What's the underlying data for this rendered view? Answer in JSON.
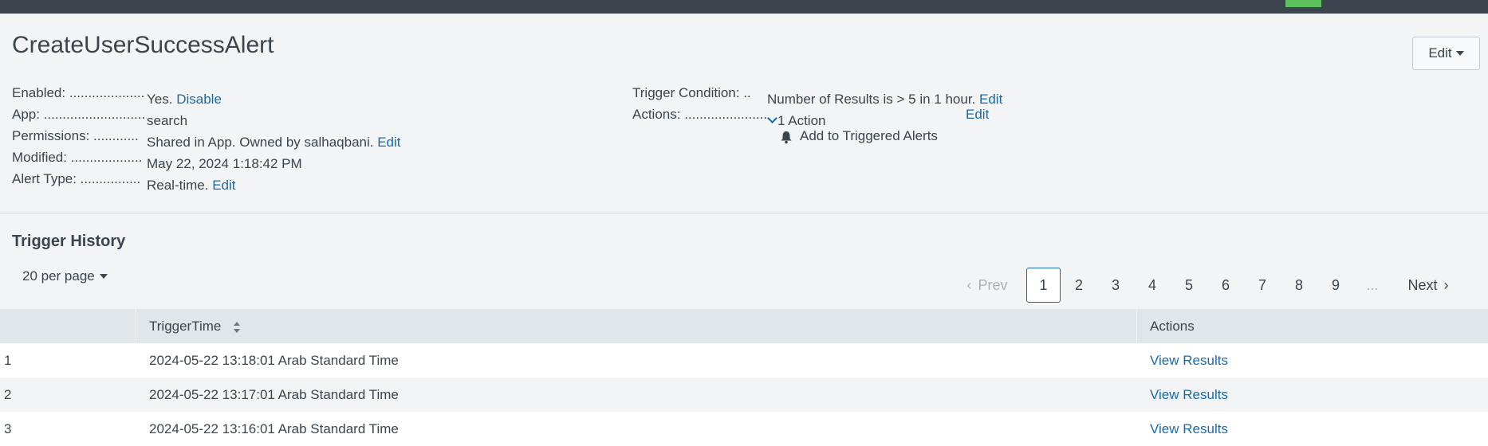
{
  "alert": {
    "title": "CreateUserSuccessAlert",
    "edit_button": "Edit"
  },
  "details_left": [
    {
      "label": "Enabled: ....................",
      "value": "Yes.",
      "link": "Disable"
    },
    {
      "label": "App: ..............................",
      "value": "search",
      "link": ""
    },
    {
      "label": "Permissions: ............",
      "value": "Shared in App. Owned by salhaqbani.",
      "link": "Edit"
    },
    {
      "label": "Modified: ...................",
      "value": "May 22, 2024 1:18:42 PM",
      "link": ""
    },
    {
      "label": "Alert Type: ................",
      "value": "Real-time.",
      "link": "Edit"
    }
  ],
  "details_right": {
    "trigger_condition": {
      "label": "Trigger Condition: ..",
      "value": "Number of Results is > 5 in 1 hour.",
      "link": "Edit"
    },
    "actions": {
      "label": "Actions: ......................",
      "value": "1 Action",
      "link": "Edit"
    },
    "action_items": [
      "Add to Triggered Alerts"
    ]
  },
  "history": {
    "title": "Trigger History",
    "per_page": "20 per page",
    "pagination": {
      "prev": "Prev",
      "next": "Next",
      "pages": [
        "1",
        "2",
        "3",
        "4",
        "5",
        "6",
        "7",
        "8",
        "9"
      ],
      "ellipsis": "...",
      "current": "1"
    },
    "columns": [
      "",
      "TriggerTime",
      "Actions"
    ],
    "rows": [
      {
        "num": "1",
        "time": "2024-05-22 13:18:01 Arab Standard Time",
        "action": "View Results"
      },
      {
        "num": "2",
        "time": "2024-05-22 13:17:01 Arab Standard Time",
        "action": "View Results"
      },
      {
        "num": "3",
        "time": "2024-05-22 13:16:01 Arab Standard Time",
        "action": "View Results"
      }
    ]
  },
  "colors": {
    "link": "#1a6aa7",
    "topbar": "#3c444d",
    "accent_green": "#5cc05c"
  }
}
